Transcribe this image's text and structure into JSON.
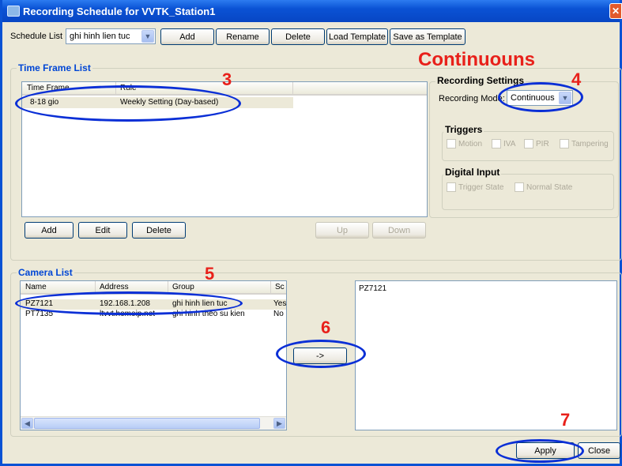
{
  "window": {
    "title": "Recording Schedule for VVTK_Station1"
  },
  "toolbar": {
    "schedule_list_label": "Schedule List",
    "schedule_value": "ghi hinh lien tuc",
    "add": "Add",
    "rename": "Rename",
    "delete": "Delete",
    "load_template": "Load Template",
    "save_template": "Save as Template"
  },
  "time_frame": {
    "title": "Time Frame List",
    "columns": [
      "Time Frame",
      "Rule"
    ],
    "rows": [
      {
        "frame": "8-18 gio",
        "rule": "Weekly Setting (Day-based)"
      }
    ],
    "add": "Add",
    "edit": "Edit",
    "delete": "Delete",
    "up": "Up",
    "down": "Down"
  },
  "recording": {
    "title": "Recording Settings",
    "mode_label": "Recording Mode:",
    "mode_value": "Continuous",
    "triggers_title": "Triggers",
    "triggers": [
      "Motion",
      "IVA",
      "PIR",
      "Tampering"
    ],
    "digital_title": "Digital Input",
    "digital": [
      "Trigger State",
      "Normal State"
    ]
  },
  "camera": {
    "title": "Camera List",
    "columns": [
      "Name",
      "Address",
      "Group",
      "Sc"
    ],
    "rows": [
      {
        "name": "PZ7121",
        "address": "192.168.1.208",
        "group": "ghi hinh lien tuc",
        "sch": "Yes"
      },
      {
        "name": "PT7135",
        "address": "ltvvt.homeip.net",
        "group": "ghi hinh theo su kien",
        "sch": "No"
      }
    ],
    "arrow_button": "->",
    "selected": [
      "PZ7121"
    ]
  },
  "footer": {
    "apply": "Apply",
    "close": "Close"
  },
  "annotations": {
    "heading": "Continuouns",
    "n3": "3",
    "n4": "4",
    "n5": "5",
    "n6": "6",
    "n7": "7",
    "color_number": "#e8201a",
    "color_ellipse": "#0a2fd6"
  }
}
